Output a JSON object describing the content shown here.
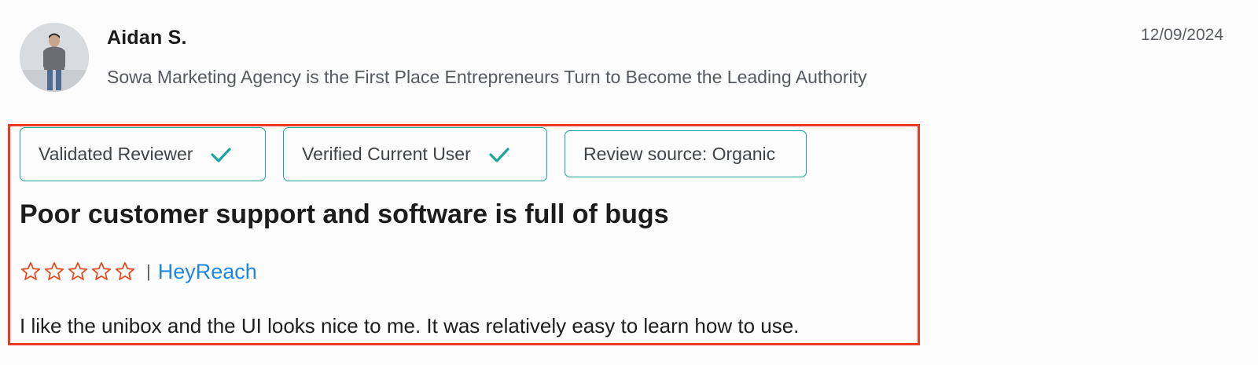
{
  "reviewer": {
    "name": "Aidan S.",
    "company": "Sowa Marketing Agency is the First Place Entrepreneurs Turn to Become the Leading Authority",
    "date": "12/09/2024"
  },
  "badges": [
    {
      "label": "Validated Reviewer",
      "icon": "check-icon"
    },
    {
      "label": "Verified Current User",
      "icon": "check-icon"
    },
    {
      "label": "Review source: Organic"
    }
  ],
  "review": {
    "title": "Poor customer support and software is full of bugs",
    "rating": {
      "filled": 0,
      "max": 5
    },
    "separator": "|",
    "product": "HeyReach",
    "body": "I like the unibox and the UI looks nice to me. It was relatively easy to learn how to use."
  },
  "colors": {
    "accent_teal": "#1aa69a",
    "star_outline": "#e5481f",
    "link_blue": "#1f86e6",
    "highlight_frame": "#ea3a24"
  }
}
